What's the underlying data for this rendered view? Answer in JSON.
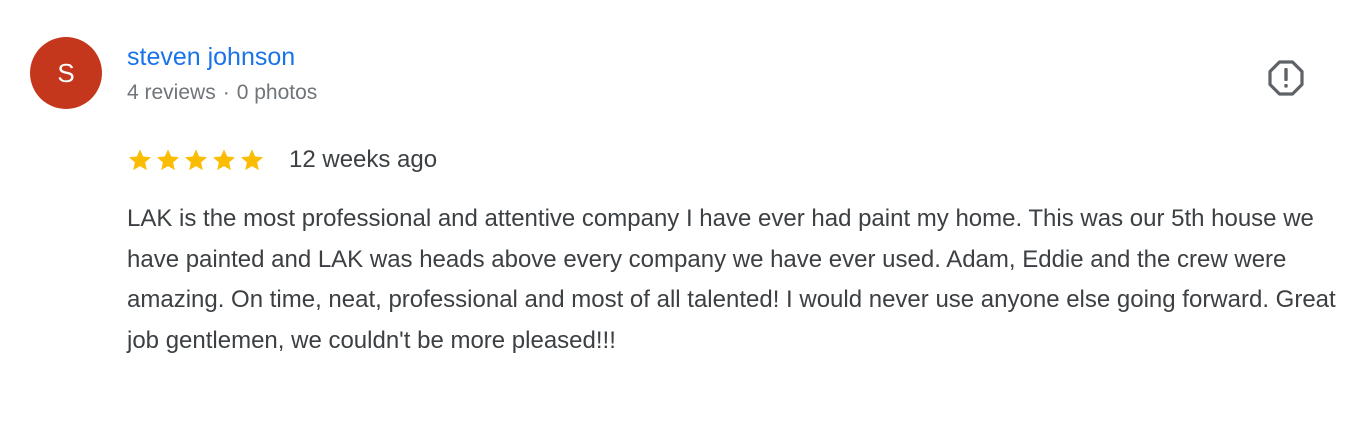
{
  "review": {
    "avatar_initial": "S",
    "author_name": "steven johnson",
    "reviews_count": "4 reviews",
    "separator": "·",
    "photos_count": "0 photos",
    "rating": 5,
    "rating_max": 5,
    "date": "12 weeks ago",
    "text": "LAK is the most professional and attentive company I have ever had paint my home. This was our 5th house we have painted and LAK was heads above every company we have ever used. Adam, Eddie and the crew were amazing. On time, neat, professional and most of all talented! I would never use anyone else going forward. Great job gentlemen, we couldn't be more pleased!!!"
  },
  "icons": {
    "flag": "report-flag-icon",
    "star": "star-icon"
  },
  "colors": {
    "avatar_bg": "#c5371c",
    "author_link": "#1a73e8",
    "star_fill": "#fbbc04",
    "meta_text": "#70757a",
    "body_text": "#3c4043"
  }
}
